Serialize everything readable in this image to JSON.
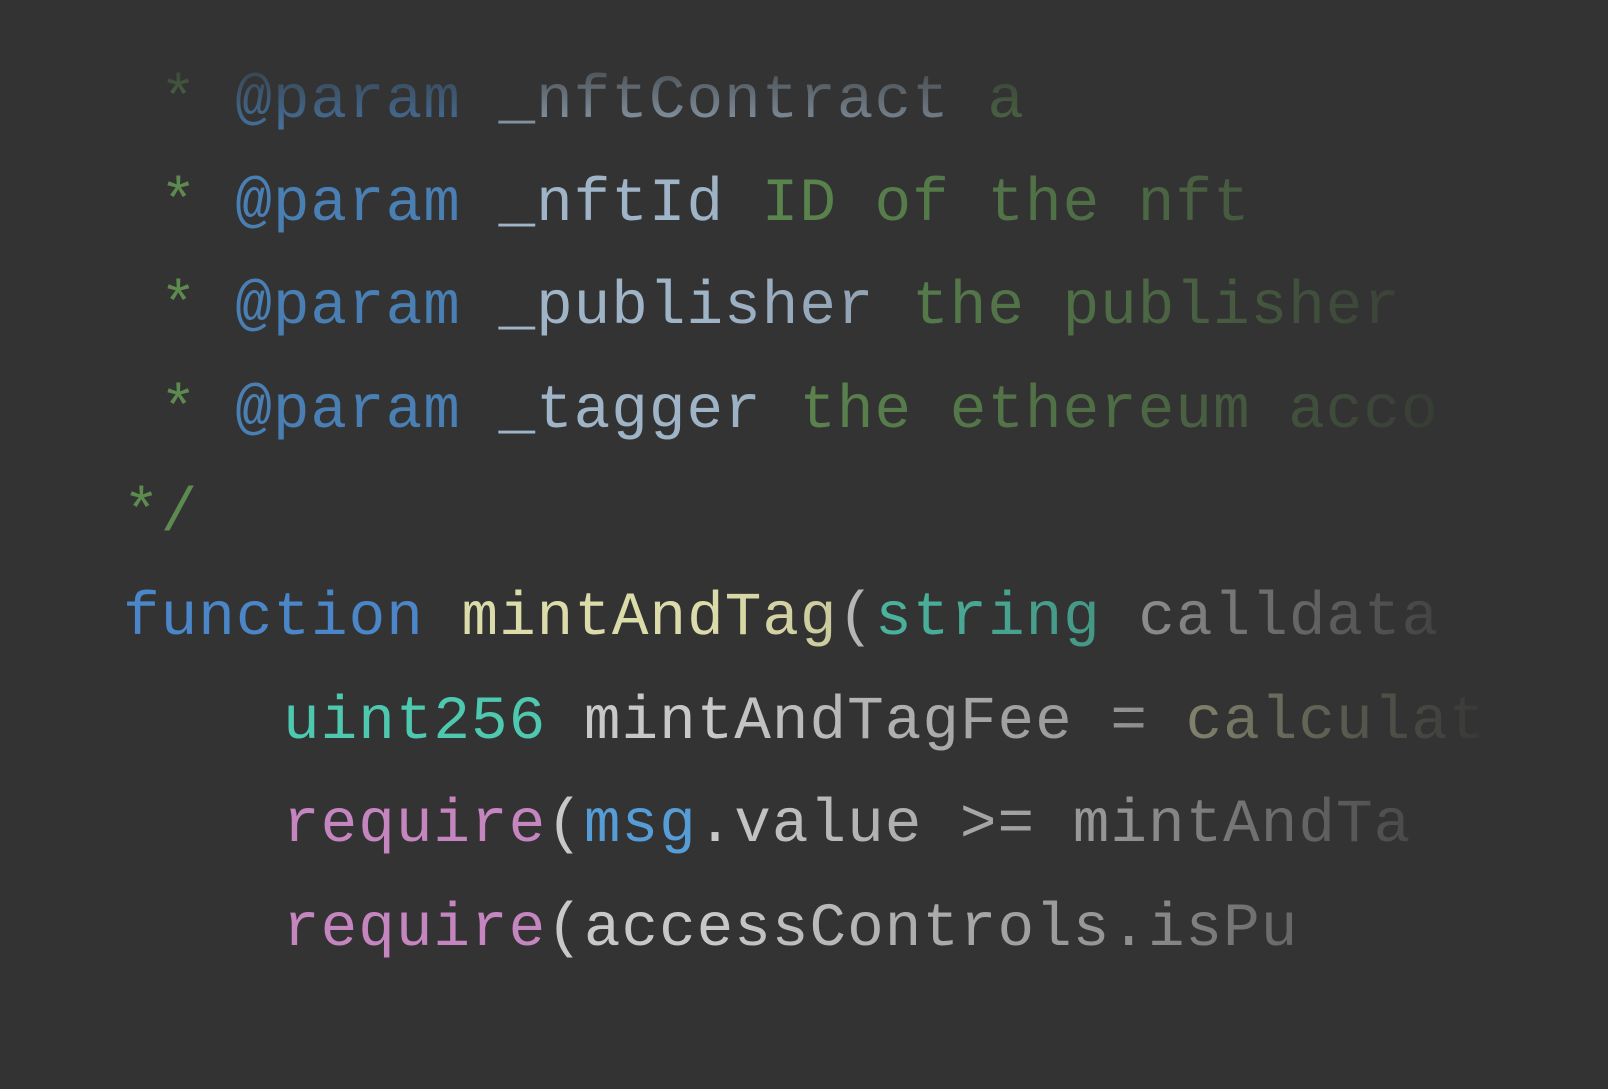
{
  "editor": {
    "lines": [
      {
        "bullet": "*",
        "tag": "@param",
        "name": "_nftContract",
        "desc": "a"
      },
      {
        "bullet": "*",
        "tag": "@param",
        "name": "_nftId",
        "desc": "ID of the nft"
      },
      {
        "bullet": "*",
        "tag": "@param",
        "name": "_publisher",
        "desc": "the publisher"
      },
      {
        "bullet": "*",
        "tag": "@param",
        "name": "_tagger",
        "desc": "the ethereum acco"
      },
      {
        "text": "*/"
      },
      {
        "keyword": "function",
        "name": "mintAndTag",
        "paren": "(",
        "type": "string",
        "rest": "calldata"
      },
      {
        "type": "uint256",
        "var": "mintAndTagFee",
        "op": "=",
        "call": "calculat"
      },
      {
        "fn": "require",
        "paren": "(",
        "obj": "msg",
        "rest": ".value >= mintAndTa"
      },
      {
        "fn": "require",
        "paren": "(",
        "rest": "accessControls.isPu"
      }
    ]
  },
  "colors": {
    "background": "#333333",
    "comment": "#5d8a4f",
    "doc_tag": "#4a7fb4",
    "keyword": "#4a86c8",
    "function_name": "#dcdcaa",
    "type": "#4ec9b0",
    "plain": "#c8c8c8",
    "require": "#c586c0"
  }
}
